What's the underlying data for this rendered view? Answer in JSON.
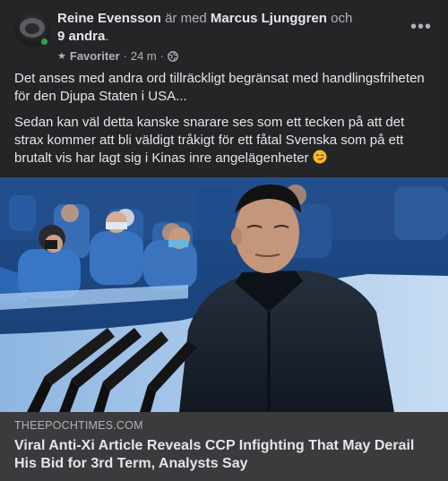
{
  "post": {
    "author": "Reine Evensson",
    "with_word": "är med",
    "tagged_person": "Marcus Ljunggren",
    "and_word": "och",
    "others": "9 andra",
    "period": ".",
    "audience_label": "Favoriter",
    "separator": "·",
    "timestamp": "24 m",
    "separator2": "·",
    "paragraph_1": "Det anses med andra ord tillräckligt begränsat med handlingsfriheten för den Djupa Staten i USA...",
    "paragraph_2": "Sedan kan väl detta kanske snarare ses som ett tecken på att det strax kommer att bli väldigt tråkigt för ett fåtal Svenska som på ett brutalt vis har lagt sig i Kinas inre angelägenheter",
    "more_label": "•••"
  },
  "link_preview": {
    "domain": "THEEPOCHTIMES.COM",
    "headline": "Viral Anti-Xi Article Reveals CCP Infighting That May Derail His Bid for 3rd Term, Analysts Say"
  },
  "colors": {
    "background": "#242526",
    "link_box": "#3a3b3c",
    "online": "#31a24c",
    "text_primary": "#e4e6eb",
    "text_secondary": "#b0b3b8"
  },
  "icons": {
    "audience": "star-icon",
    "privacy": "globe-icon",
    "menu": "more-icon",
    "emoji": "smirk-emoji-icon"
  }
}
